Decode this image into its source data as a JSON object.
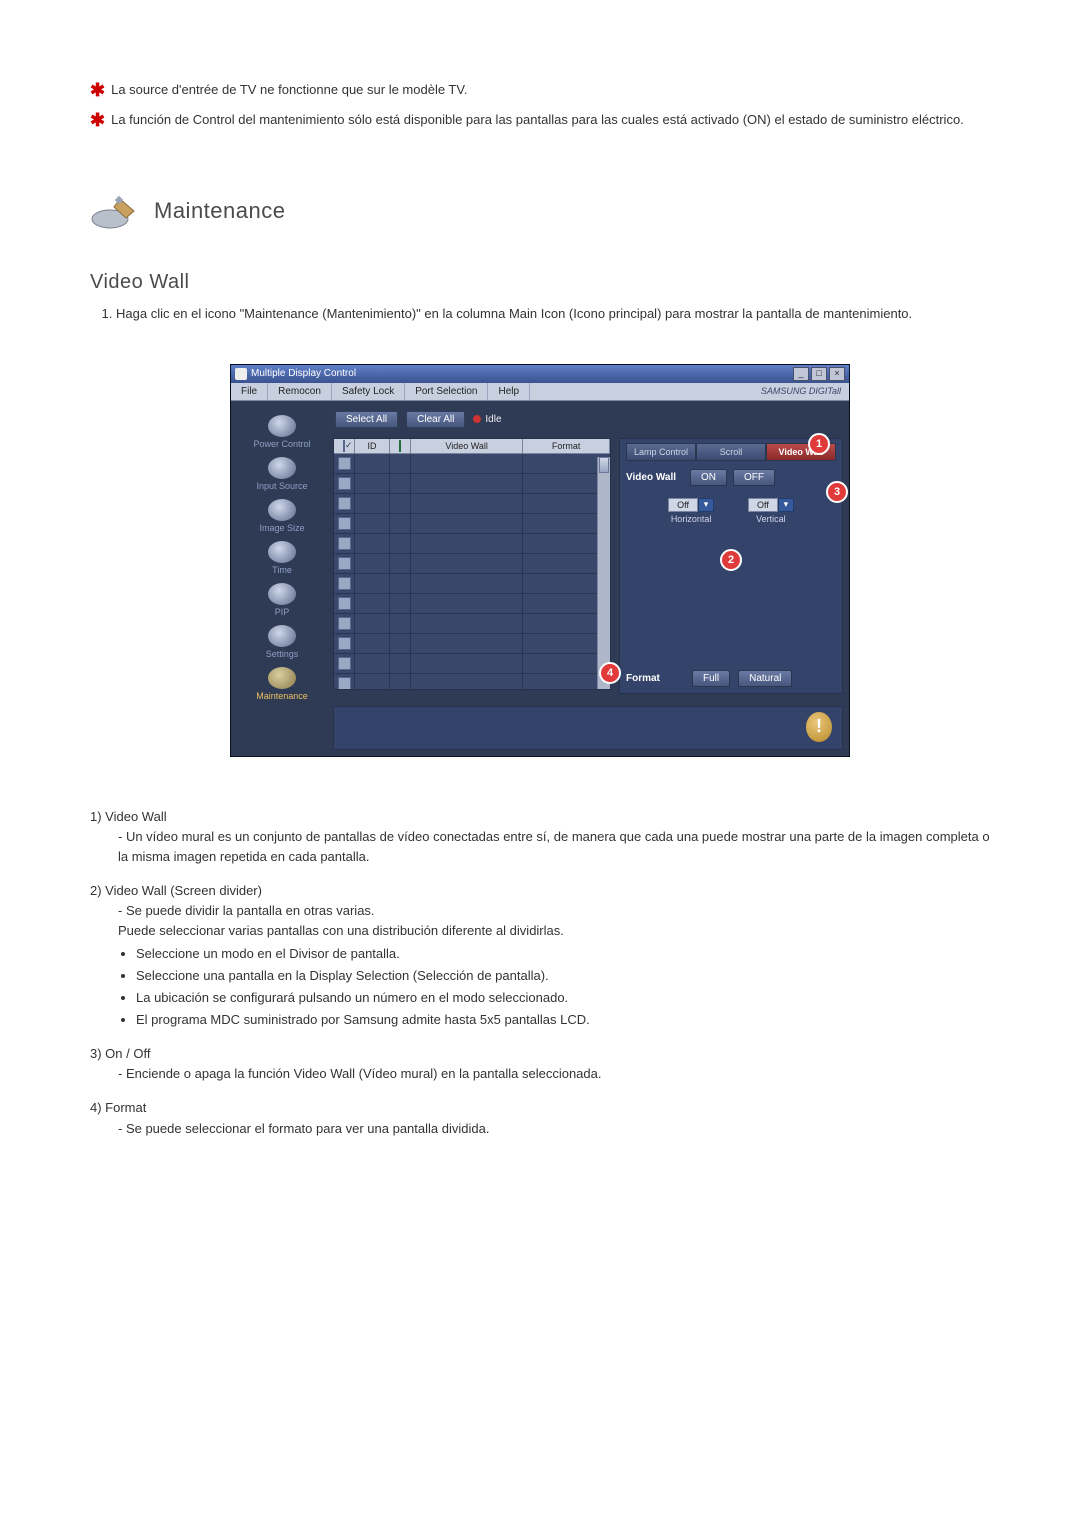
{
  "notes": {
    "n1": "La source d'entrée de TV ne fonctionne que sur le modèle TV.",
    "n2": "La función de Control del mantenimiento sólo está disponible para las pantallas para las cuales está activado (ON) el estado de suministro eléctrico."
  },
  "section": {
    "title": "Maintenance",
    "subsection": "Video Wall",
    "intro_item": "Haga clic en el icono \"Maintenance (Mantenimiento)\" en la columna Main Icon (Icono principal) para mostrar la pantalla de mantenimiento."
  },
  "app": {
    "title": "Multiple Display Control",
    "brand": "SAMSUNG DIGITall",
    "menu": [
      "File",
      "Remocon",
      "Safety Lock",
      "Port Selection",
      "Help"
    ],
    "sidebar": [
      {
        "label": "Power Control"
      },
      {
        "label": "Input Source"
      },
      {
        "label": "Image Size"
      },
      {
        "label": "Time"
      },
      {
        "label": "PIP"
      },
      {
        "label": "Settings"
      },
      {
        "label": "Maintenance",
        "active": true
      }
    ],
    "toolbar": {
      "select_all": "Select All",
      "clear_all": "Clear All",
      "idle": "Idle"
    },
    "grid": {
      "headers": {
        "chk": "",
        "id": "ID",
        "status": "",
        "video_wall": "Video Wall",
        "format": "Format"
      },
      "row_count": 12
    },
    "ctrl": {
      "tabs": [
        "Lamp Control",
        "Scroll",
        "Video Wall"
      ],
      "active_tab": "Video Wall",
      "video_wall_label": "Video Wall",
      "on": "ON",
      "off": "OFF",
      "dd1_value": "Off",
      "dd1_caption": "Horizontal",
      "dd2_value": "Off",
      "dd2_caption": "Vertical",
      "format_label": "Format",
      "full": "Full",
      "natural": "Natural"
    },
    "badges": {
      "b1": "1",
      "b2": "2",
      "b3": "3",
      "b4": "4"
    },
    "win_controls": {
      "min": "_",
      "max": "□",
      "close": "×"
    }
  },
  "desc": {
    "d1_head": "1)  Video Wall",
    "d1_dash": "- Un vídeo mural es un conjunto de pantallas de vídeo conectadas entre sí, de manera que cada una puede mostrar una parte de la imagen completa o la misma imagen repetida en cada pantalla.",
    "d2_head": "2)  Video Wall (Screen divider)",
    "d2_dash1": "- Se puede dividir la pantalla en otras varias.",
    "d2_dash2": "Puede seleccionar varias pantallas con una distribución diferente al dividirlas.",
    "d2_b": [
      "Seleccione un modo en el Divisor de pantalla.",
      "Seleccione una pantalla en la Display Selection (Selección de pantalla).",
      "La ubicación se configurará pulsando un número en el modo seleccionado.",
      "El programa MDC suministrado por Samsung admite hasta 5x5 pantallas LCD."
    ],
    "d3_head": "3)  On / Off",
    "d3_dash": "- Enciende o apaga la función Video Wall (Vídeo mural) en la pantalla seleccionada.",
    "d4_head": "4)  Format",
    "d4_dash": "- Se puede seleccionar el formato para ver una pantalla dividida."
  }
}
